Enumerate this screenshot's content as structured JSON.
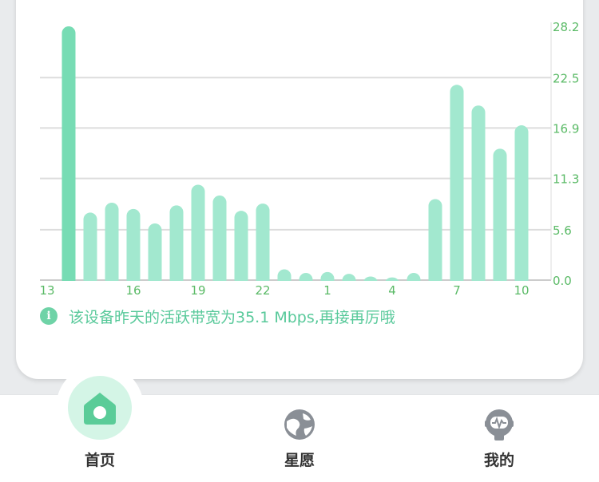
{
  "chart_data": {
    "type": "bar",
    "categories": [
      "13",
      "14",
      "15",
      "16",
      "17",
      "18",
      "19",
      "20",
      "21",
      "22",
      "23",
      "0",
      "1",
      "2",
      "3",
      "4",
      "5",
      "6",
      "7",
      "8",
      "9",
      "10",
      "11"
    ],
    "x_tick_labels": [
      "13",
      "16",
      "19",
      "22",
      "1",
      "4",
      "7",
      "10"
    ],
    "values": [
      28.2,
      7.5,
      8.6,
      7.9,
      6.3,
      8.3,
      10.6,
      9.4,
      7.7,
      8.5,
      1.2,
      0.8,
      0.9,
      0.7,
      0.4,
      0.3,
      0.8,
      9.0,
      21.7,
      19.4,
      14.6,
      17.2,
      0
    ],
    "y_ticks": [
      "0.0",
      "5.6",
      "11.3",
      "16.9",
      "22.5",
      "28.2"
    ],
    "ylim": [
      0,
      28.2
    ],
    "grid": true,
    "y_axis_side": "right",
    "colors": {
      "highlight_bar": "#77dcb4",
      "bar": "#a2e8cf",
      "axis_text": "#5aba66",
      "grid": "#dddddd"
    }
  },
  "info": {
    "icon": "info-icon",
    "icon_glyph": "i",
    "text": "该设备昨天的活跃带宽为35.1 Mbps,再接再厉哦"
  },
  "tabbar": {
    "tabs": [
      {
        "label": "首页",
        "icon": "home-icon",
        "active": true
      },
      {
        "label": "星愿",
        "icon": "planet-icon",
        "active": false
      },
      {
        "label": "我的",
        "icon": "robot-icon",
        "active": false
      }
    ]
  },
  "colors": {
    "accent": "#5acc98",
    "text_green": "#58c99a"
  }
}
